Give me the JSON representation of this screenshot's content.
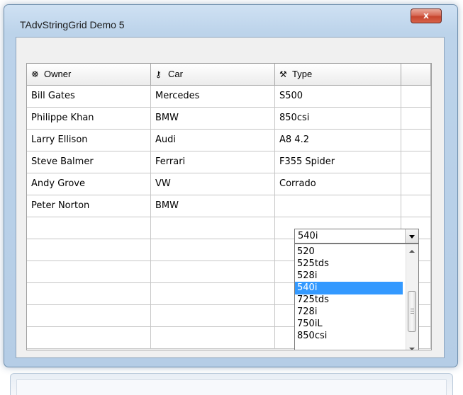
{
  "window": {
    "title": "TAdvStringGrid Demo 5",
    "close_label": "x"
  },
  "grid": {
    "columns": [
      {
        "label": "Owner",
        "icon": "owner-icon",
        "glyph": "☸"
      },
      {
        "label": "Car",
        "icon": "key-icon",
        "glyph": "⚷"
      },
      {
        "label": "Type",
        "icon": "tools-icon",
        "glyph": "⚒"
      }
    ],
    "rows": [
      [
        "Bill Gates",
        "Mercedes",
        "S500"
      ],
      [
        "Philippe Khan",
        "BMW",
        "850csi"
      ],
      [
        "Larry Ellison",
        "Audi",
        "A8 4.2"
      ],
      [
        "Steve Balmer",
        "Ferrari",
        "F355 Spider"
      ],
      [
        "Andy Grove",
        "VW",
        "Corrado"
      ],
      [
        "Peter Norton",
        "BMW",
        ""
      ]
    ],
    "editor": {
      "value": "540i",
      "options": [
        "520",
        "525tds",
        "528i",
        "540i",
        "725tds",
        "728i",
        "750iL",
        "850csi"
      ],
      "selected": "540i"
    }
  }
}
